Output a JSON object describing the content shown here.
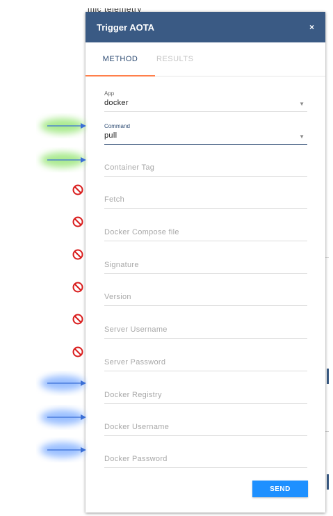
{
  "background": {
    "partial_text": "mic telemetry"
  },
  "dialog": {
    "title": "Trigger AOTA",
    "close_glyph": "×",
    "header_color": "#3a5a84",
    "tabs": [
      {
        "label": "METHOD",
        "active": true
      },
      {
        "label": "RESULTS",
        "active": false
      }
    ],
    "tab_indicator_color": "#ff7f4a",
    "fields": {
      "app": {
        "label": "App",
        "value": "docker"
      },
      "command": {
        "label": "Command",
        "value": "pull"
      },
      "container_tag": {
        "placeholder": "Container Tag"
      },
      "fetch": {
        "placeholder": "Fetch"
      },
      "docker_compose_file": {
        "placeholder": "Docker Compose file"
      },
      "signature": {
        "placeholder": "Signature"
      },
      "version": {
        "placeholder": "Version"
      },
      "server_username": {
        "placeholder": "Server Username"
      },
      "server_password": {
        "placeholder": "Server Password"
      },
      "docker_registry": {
        "placeholder": "Docker Registry"
      },
      "docker_username": {
        "placeholder": "Docker Username"
      },
      "docker_password": {
        "placeholder": "Docker Password"
      }
    },
    "send_label": "SEND",
    "send_color": "#1e90ff"
  },
  "annotations": {
    "arrow_icon": "arrow-right-icon",
    "blocked_icon": "no-entry-icon",
    "green_highlight": "#8ee36a",
    "blue_highlight": "#6fa4ff",
    "arrow_color": "#3b6fd6",
    "blocked_color": "#d91c1c"
  }
}
